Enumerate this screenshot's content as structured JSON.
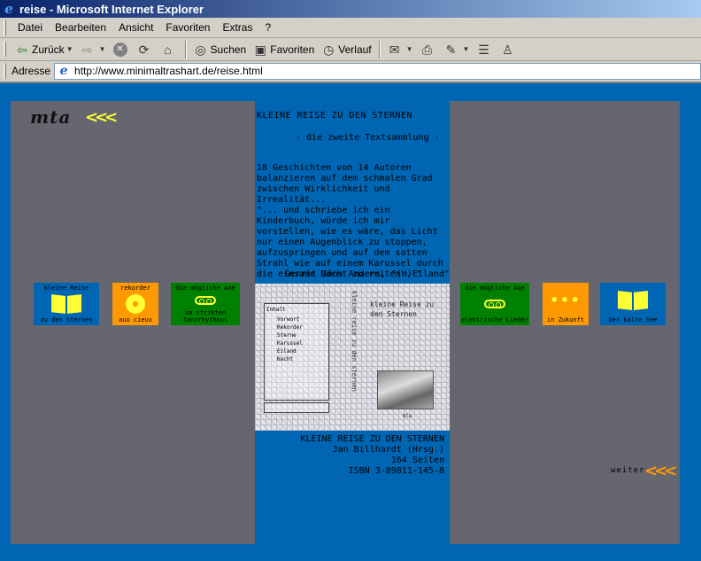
{
  "window": {
    "title": "reise - Microsoft Internet Explorer"
  },
  "menu": [
    "Datei",
    "Bearbeiten",
    "Ansicht",
    "Favoriten",
    "Extras",
    "?"
  ],
  "toolbar": {
    "back": "Zurück",
    "search": "Suchen",
    "favorites": "Favoriten",
    "history": "Verlauf"
  },
  "address": {
    "label": "Adresse",
    "url": "http://www.minimaltrashart.de/reise.html"
  },
  "site": {
    "logo": "mta",
    "chevrons": "<<<"
  },
  "content": {
    "title": "KLEINE REISE ZU DEN STERNEN",
    "subtitle": "- die zweite Textsammlung -",
    "description": "18 Geschichten von 14 Autoren balanzieren auf dem schmalen Grad zwischen Wirklichkeit und Irrealität...",
    "quote": "\"... und schriebe ich ein Kinderbuch, würde ich mir vorstellen, wie es wäre, das Licht nur einen Augenblick zu stoppen, aufzuspringen und auf dem satten Strahl wie auf einem Karussel durch die einsame Nacht zu reiten...\"",
    "quote_author": "Gerrit Jöns Anders, \"(H)Eiland\"",
    "book_title": "KLEINE REISE ZU DEN STERNEN",
    "editor": "Jan Billhardt (Hrsg.)",
    "pages": "164 Seiten",
    "isbn": "ISBN 3-89811-145-8"
  },
  "cover": {
    "spine": "kleine reise zu den sternen",
    "title": "kleine Reise zu den Sternen",
    "toc_head": "Inhalt",
    "toc_entries": [
      "Vorwort",
      "Rekorder",
      "Sterne",
      "Karussel",
      "Eiland",
      "Nacht"
    ],
    "caption": "mta"
  },
  "nav": [
    {
      "top": "kleine Reise",
      "bottom": "zu den Sternen",
      "icon": "book-icon"
    },
    {
      "top": "rekorder",
      "bottom": "aux cieux",
      "icon": "cd-icon"
    },
    {
      "top": "die mögliche Aue",
      "bottom": "im strikten Tanzrhythmus",
      "icon": "tape-icon"
    },
    {
      "top": "die mögliche Aue",
      "bottom": "elektrische Lieder",
      "icon": "tape-icon"
    },
    {
      "top": "",
      "bottom": "in Zukunft",
      "icon": "dots-icon"
    },
    {
      "top": "",
      "bottom": "Der kalte See",
      "icon": "book-icon"
    }
  ],
  "weiter": "weiter",
  "colors": {
    "page_blue": "#0066b3",
    "panel_gray": "#666670",
    "orange": "#ff9900",
    "green": "#008000",
    "yellow": "#ffff33"
  }
}
